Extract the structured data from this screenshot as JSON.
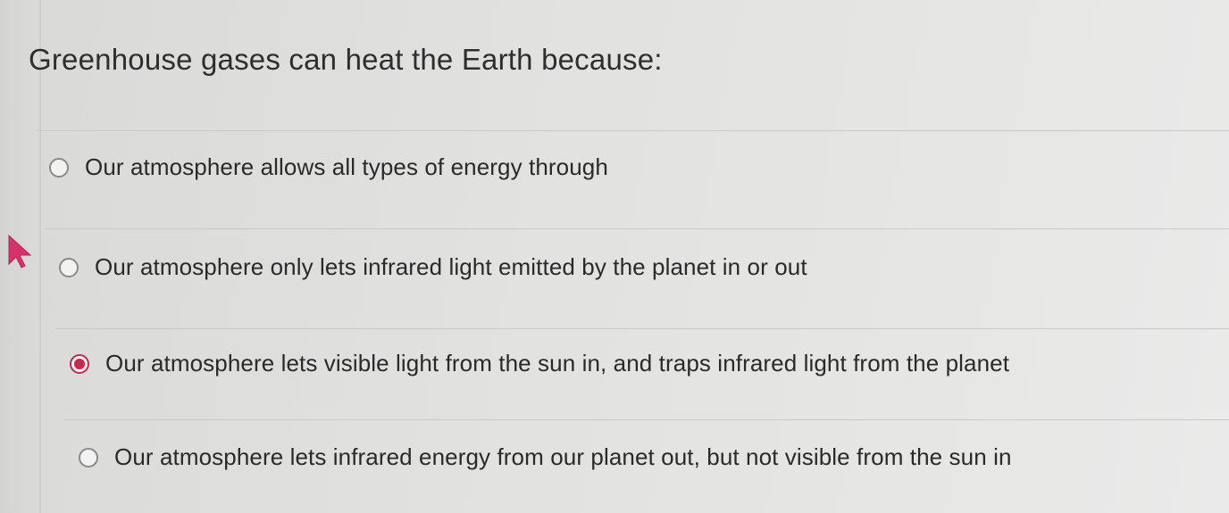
{
  "question": {
    "title": "Greenhouse gases can heat the Earth because:"
  },
  "options": [
    {
      "label": "Our atmosphere allows all types of energy through",
      "selected": false
    },
    {
      "label": "Our atmosphere only lets infrared light emitted by the planet in or out",
      "selected": false
    },
    {
      "label": "Our atmosphere lets visible light from the sun in, and traps infrared light from the planet",
      "selected": true
    },
    {
      "label": "Our atmosphere lets infrared energy from our planet out, but not visible from the sun in",
      "selected": false
    }
  ],
  "colors": {
    "selected_accent": "#c8294c",
    "cursor": "#d6336c"
  },
  "icons": {
    "cursor": "pointer-arrow-icon"
  }
}
